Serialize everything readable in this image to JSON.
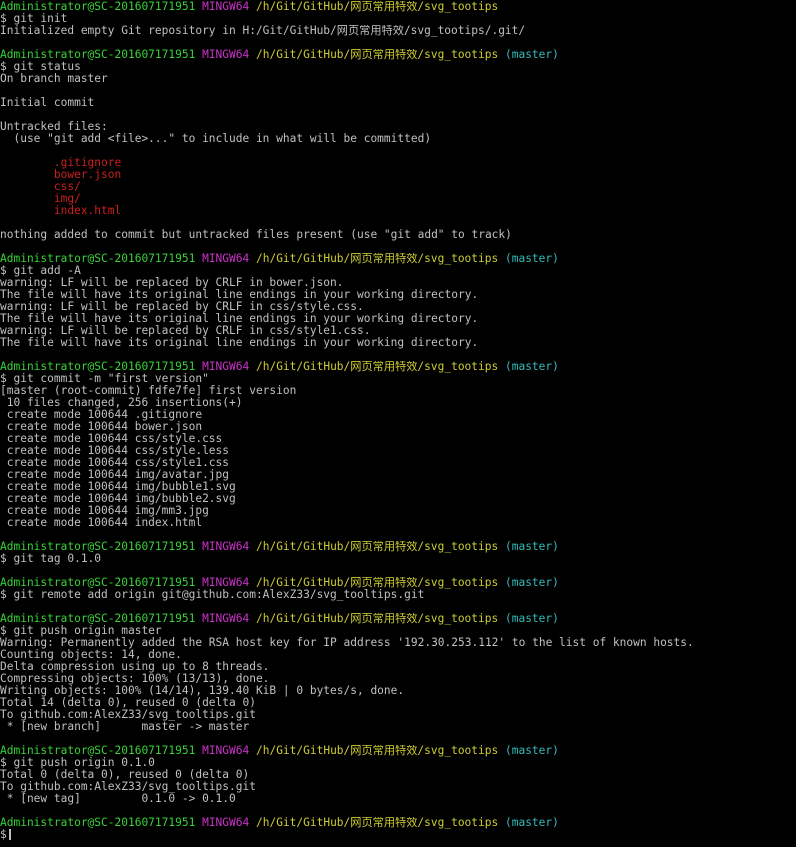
{
  "colors": {
    "background": "#000000",
    "text": "#c0c0c0",
    "prompt_user": "#36d336",
    "prompt_host": "#c933c9",
    "prompt_path": "#cccc33",
    "prompt_branch": "#33b9b9",
    "untracked_file": "#cc1f1f"
  },
  "prompt": {
    "user": "Administrator@SC-201607171951",
    "host": "MINGW64",
    "path": "/h/Git/GitHub/网页常用特效/svg_tootips",
    "branch": "(master)"
  },
  "lines": [
    {
      "kind": "prompt",
      "branch": false
    },
    {
      "kind": "cmd",
      "text": "$ git init"
    },
    {
      "kind": "out",
      "text": "Initialized empty Git repository in H:/Git/GitHub/网页常用特效/svg_tootips/.git/"
    },
    {
      "kind": "out",
      "text": ""
    },
    {
      "kind": "prompt",
      "branch": true
    },
    {
      "kind": "cmd",
      "text": "$ git status"
    },
    {
      "kind": "out",
      "text": "On branch master"
    },
    {
      "kind": "out",
      "text": ""
    },
    {
      "kind": "out",
      "text": "Initial commit"
    },
    {
      "kind": "out",
      "text": ""
    },
    {
      "kind": "out",
      "text": "Untracked files:"
    },
    {
      "kind": "out",
      "text": "  (use \"git add <file>...\" to include in what will be committed)"
    },
    {
      "kind": "out",
      "text": ""
    },
    {
      "kind": "err",
      "text": "        .gitignore"
    },
    {
      "kind": "err",
      "text": "        bower.json"
    },
    {
      "kind": "err",
      "text": "        css/"
    },
    {
      "kind": "err",
      "text": "        img/"
    },
    {
      "kind": "err",
      "text": "        index.html"
    },
    {
      "kind": "out",
      "text": ""
    },
    {
      "kind": "out",
      "text": "nothing added to commit but untracked files present (use \"git add\" to track)"
    },
    {
      "kind": "out",
      "text": ""
    },
    {
      "kind": "prompt",
      "branch": true
    },
    {
      "kind": "cmd",
      "text": "$ git add -A"
    },
    {
      "kind": "out",
      "text": "warning: LF will be replaced by CRLF in bower.json."
    },
    {
      "kind": "out",
      "text": "The file will have its original line endings in your working directory."
    },
    {
      "kind": "out",
      "text": "warning: LF will be replaced by CRLF in css/style.css."
    },
    {
      "kind": "out",
      "text": "The file will have its original line endings in your working directory."
    },
    {
      "kind": "out",
      "text": "warning: LF will be replaced by CRLF in css/style1.css."
    },
    {
      "kind": "out",
      "text": "The file will have its original line endings in your working directory."
    },
    {
      "kind": "out",
      "text": ""
    },
    {
      "kind": "prompt",
      "branch": true
    },
    {
      "kind": "cmd",
      "text": "$ git commit -m \"first version\""
    },
    {
      "kind": "out",
      "text": "[master (root-commit) fdfe7fe] first version"
    },
    {
      "kind": "out",
      "text": " 10 files changed, 256 insertions(+)"
    },
    {
      "kind": "out",
      "text": " create mode 100644 .gitignore"
    },
    {
      "kind": "out",
      "text": " create mode 100644 bower.json"
    },
    {
      "kind": "out",
      "text": " create mode 100644 css/style.css"
    },
    {
      "kind": "out",
      "text": " create mode 100644 css/style.less"
    },
    {
      "kind": "out",
      "text": " create mode 100644 css/style1.css"
    },
    {
      "kind": "out",
      "text": " create mode 100644 img/avatar.jpg"
    },
    {
      "kind": "out",
      "text": " create mode 100644 img/bubble1.svg"
    },
    {
      "kind": "out",
      "text": " create mode 100644 img/bubble2.svg"
    },
    {
      "kind": "out",
      "text": " create mode 100644 img/mm3.jpg"
    },
    {
      "kind": "out",
      "text": " create mode 100644 index.html"
    },
    {
      "kind": "out",
      "text": ""
    },
    {
      "kind": "prompt",
      "branch": true
    },
    {
      "kind": "cmd",
      "text": "$ git tag 0.1.0"
    },
    {
      "kind": "out",
      "text": ""
    },
    {
      "kind": "prompt",
      "branch": true
    },
    {
      "kind": "cmd",
      "text": "$ git remote add origin git@github.com:AlexZ33/svg_tooltips.git"
    },
    {
      "kind": "out",
      "text": ""
    },
    {
      "kind": "prompt",
      "branch": true
    },
    {
      "kind": "cmd",
      "text": "$ git push origin master"
    },
    {
      "kind": "out",
      "text": "Warning: Permanently added the RSA host key for IP address '192.30.253.112' to the list of known hosts."
    },
    {
      "kind": "out",
      "text": "Counting objects: 14, done."
    },
    {
      "kind": "out",
      "text": "Delta compression using up to 8 threads."
    },
    {
      "kind": "out",
      "text": "Compressing objects: 100% (13/13), done."
    },
    {
      "kind": "out",
      "text": "Writing objects: 100% (14/14), 139.40 KiB | 0 bytes/s, done."
    },
    {
      "kind": "out",
      "text": "Total 14 (delta 0), reused 0 (delta 0)"
    },
    {
      "kind": "out",
      "text": "To github.com:AlexZ33/svg_tooltips.git"
    },
    {
      "kind": "out",
      "text": " * [new branch]      master -> master"
    },
    {
      "kind": "out",
      "text": ""
    },
    {
      "kind": "prompt",
      "branch": true
    },
    {
      "kind": "cmd",
      "text": "$ git push origin 0.1.0"
    },
    {
      "kind": "out",
      "text": "Total 0 (delta 0), reused 0 (delta 0)"
    },
    {
      "kind": "out",
      "text": "To github.com:AlexZ33/svg_tooltips.git"
    },
    {
      "kind": "out",
      "text": " * [new tag]         0.1.0 -> 0.1.0"
    },
    {
      "kind": "out",
      "text": ""
    },
    {
      "kind": "prompt",
      "branch": true
    },
    {
      "kind": "input",
      "text": "$"
    }
  ]
}
